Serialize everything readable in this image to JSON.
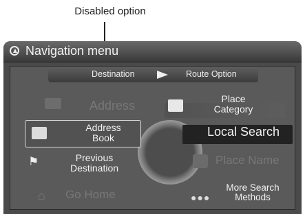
{
  "callout": {
    "label": "Disabled option"
  },
  "header": {
    "title": "Navigation menu"
  },
  "tabs": {
    "destination": "Destination",
    "route_option": "Route Option"
  },
  "left_items": {
    "address": "Address",
    "address_book": "Address\nBook",
    "previous_destination": "Previous\nDestination",
    "go_home": "Go Home"
  },
  "right_items": {
    "place_category": "Place\nCategory",
    "local_search": "Local Search",
    "place_name": "Place Name",
    "more_search_methods": "More Search\nMethods"
  },
  "icons": {
    "header": "compass-icon",
    "address": "map-icon",
    "address_book": "book-icon",
    "previous_destination": "checkered-flag-icon",
    "go_home": "home-icon",
    "place_category": "category-icon",
    "place_name": "search-map-icon",
    "more_search_methods": "ellipsis-icon"
  }
}
